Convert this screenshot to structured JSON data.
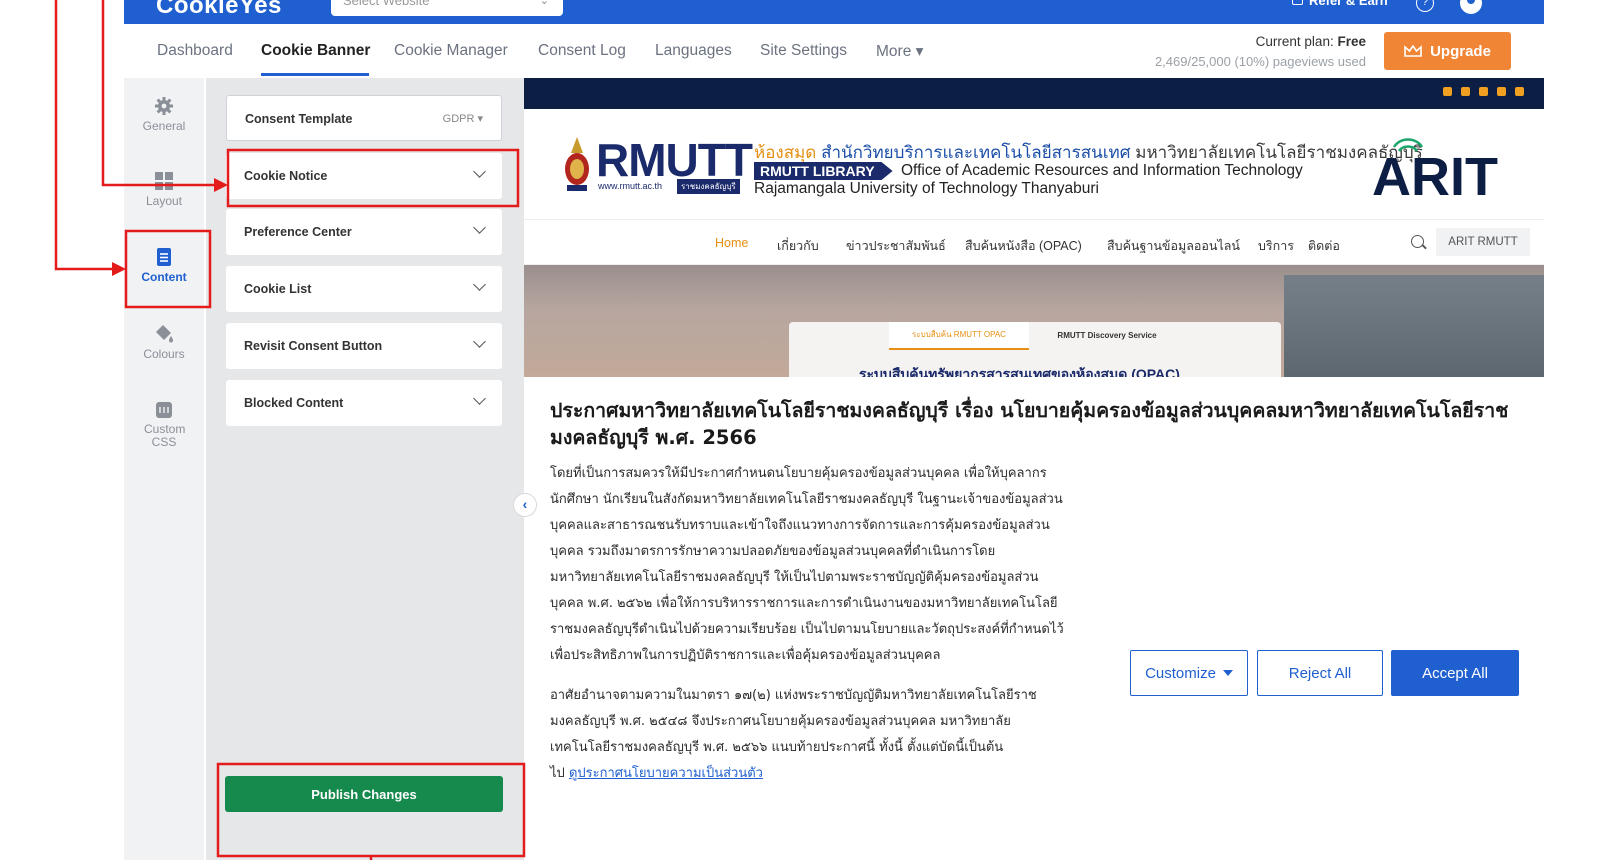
{
  "topbar": {
    "logo": "CookieYes",
    "site_select_placeholder": "Select Website",
    "refer_label": "Refer & Earn",
    "help_icon": "question-icon",
    "avatar_icon": "user-avatar-icon"
  },
  "nav": {
    "items": [
      "Dashboard",
      "Cookie Banner",
      "Cookie Manager",
      "Consent Log",
      "Languages",
      "Site Settings",
      "More ▾"
    ],
    "active": "Cookie Banner",
    "plan_label": "Current plan:",
    "plan_value": "Free",
    "pageviews": "2,469/25,000 (10%) pageviews used",
    "upgrade_label": "Upgrade"
  },
  "rail": {
    "items": [
      {
        "label": "General",
        "icon": "gear-icon"
      },
      {
        "label": "Layout",
        "icon": "grid-icon"
      },
      {
        "label": "Content",
        "icon": "document-icon"
      },
      {
        "label": "Colours",
        "icon": "paint-icon"
      },
      {
        "label": "Custom CSS",
        "icon": "css-icon"
      }
    ],
    "active": "Content"
  },
  "panel": {
    "template_label": "Consent Template",
    "template_value": "GDPR",
    "sections": [
      "Cookie Notice",
      "Preference Center",
      "Cookie List",
      "Revisit Consent Button",
      "Blocked Content"
    ],
    "publish_label": "Publish Changes"
  },
  "preview": {
    "site": {
      "rmutt": "RMUTT",
      "rmutt_url": "www.rmutt.ac.th",
      "rmutt_tag": "ราชมงคลธัญบุรี",
      "header_orange": "ห้องสมุด",
      "header_blue": "สำนักวิทยบริการและเทคโนโลยีสารสนเทศ",
      "header_rest": "มหาวิทยาลัยเทคโนโลยีราชมงคลธัญบุรี",
      "library_tag": "RMUTT LIBRARY",
      "header_en1": "Office of Academic Resources and Information Technology",
      "header_en2": "Rajamangala University of Technology Thanyaburi",
      "arit": "ARIT",
      "menu": [
        "Home",
        "เกี่ยวกับ",
        "ข่าวประชาสัมพันธ์",
        "สืบค้นหนังสือ (OPAC)",
        "สืบค้นฐานข้อมูลออนไลน์",
        "บริการ",
        "ติดต่อ"
      ],
      "menu_search_label": "ARIT RMUTT",
      "banner_tab1": "ระบบสืบค้น RMUTT OPAC",
      "banner_tab2": "RMUTT Discovery Service",
      "banner_title": "ระบบสืบค้นทรัพยากรสารสนเทศของห้องสมุด (OPAC)"
    },
    "notice": {
      "title": "ประกาศมหาวิทยาลัยเทคโนโลยีราชมงคลธัญบุรี เรื่อง นโยบายคุ้มครองข้อมูลส่วนบุคคลมหาวิทยาลัยเทคโนโลยีราชมงคลธัญบุรี พ.ศ. 2566",
      "body1": "โดยที่เป็นการสมควรให้มีประกาศกำหนดนโยบายคุ้มครองข้อมูลส่วนบุคคล เพื่อให้บุคลากร\nนักศึกษา นักเรียนในสังกัดมหาวิทยาลัยเทคโนโลยีราชมงคลธัญบุรี ในฐานะเจ้าของข้อมูลส่วน\nบุคคลและสาธารณชนรับทราบและเข้าใจถึงแนวทางการจัดการและการคุ้มครองข้อมูลส่วน\nบุคคล รวมถึงมาตรการรักษาความปลอดภัยของข้อมูลส่วนบุคคลที่ดำเนินการโดย\nมหาวิทยาลัยเทคโนโลยีราชมงคลธัญบุรี ให้เป็นไปตามพระราชบัญญัติคุ้มครองข้อมูลส่วน\nบุคคล พ.ศ. ๒๕๖๒ เพื่อให้การบริหารราชการและการดำเนินงานของมหาวิทยาลัยเทคโนโลยี\nราชมงคลธัญบุรีดำเนินไปด้วยความเรียบร้อย เป็นไปตามนโยบายและวัตถุประสงค์ที่กำหนดไว้\nเพื่อประสิทธิภาพในการปฏิบัติราชการและเพื่อคุ้มครองข้อมูลส่วนบุคคล",
      "body2": "อาศัยอำนาจตามความในมาตรา ๑๗(๒) แห่งพระราชบัญญัติมหาวิทยาลัยเทคโนโลยีราช\nมงคลธัญบุรี พ.ศ. ๒๕๔๘ จึงประกาศนโยบายคุ้มครองข้อมูลส่วนบุคคล มหาวิทยาลัย\nเทคโนโลยีราชมงคลธัญบุรี พ.ศ. ๒๕๖๖ แนบท้ายประกาศนี้ ทั้งนี้ ตั้งแต่บัดนี้เป็นต้น\nไป ",
      "link": "ดูประกาศนโยบายความเป็นส่วนตัว",
      "customize": "Customize",
      "reject": "Reject All",
      "accept": "Accept All"
    }
  },
  "colors": {
    "brand_blue": "#1f5fcf",
    "upgrade_orange": "#f08535",
    "publish_green": "#16894d",
    "annotation_red": "#e31b1b"
  }
}
